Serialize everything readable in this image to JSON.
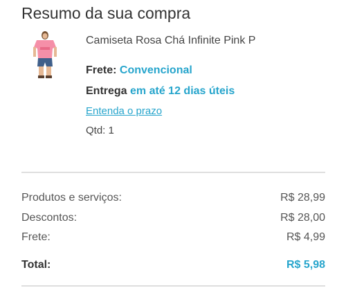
{
  "title": "Resumo da sua compra",
  "product": {
    "name": "Camiseta Rosa Chá Infinite Pink P",
    "image_icon": "tshirt-model-photo",
    "frete_label": "Frete:",
    "frete_value": "Convencional",
    "entrega_label": "Entrega",
    "entrega_value": "em até 12 dias úteis",
    "prazo_link": "Entenda o prazo",
    "qtd": "Qtd: 1"
  },
  "summary": {
    "rows": [
      {
        "label": "Produtos e serviços:",
        "value": "R$ 28,99"
      },
      {
        "label": "Descontos:",
        "value": "R$ 28,00"
      },
      {
        "label": "Frete:",
        "value": "R$ 4,99"
      }
    ],
    "total_label": "Total:",
    "total_value": "R$ 5,98"
  },
  "colors": {
    "accent": "#27a5cc",
    "text": "#333333",
    "divider": "#dedede"
  }
}
